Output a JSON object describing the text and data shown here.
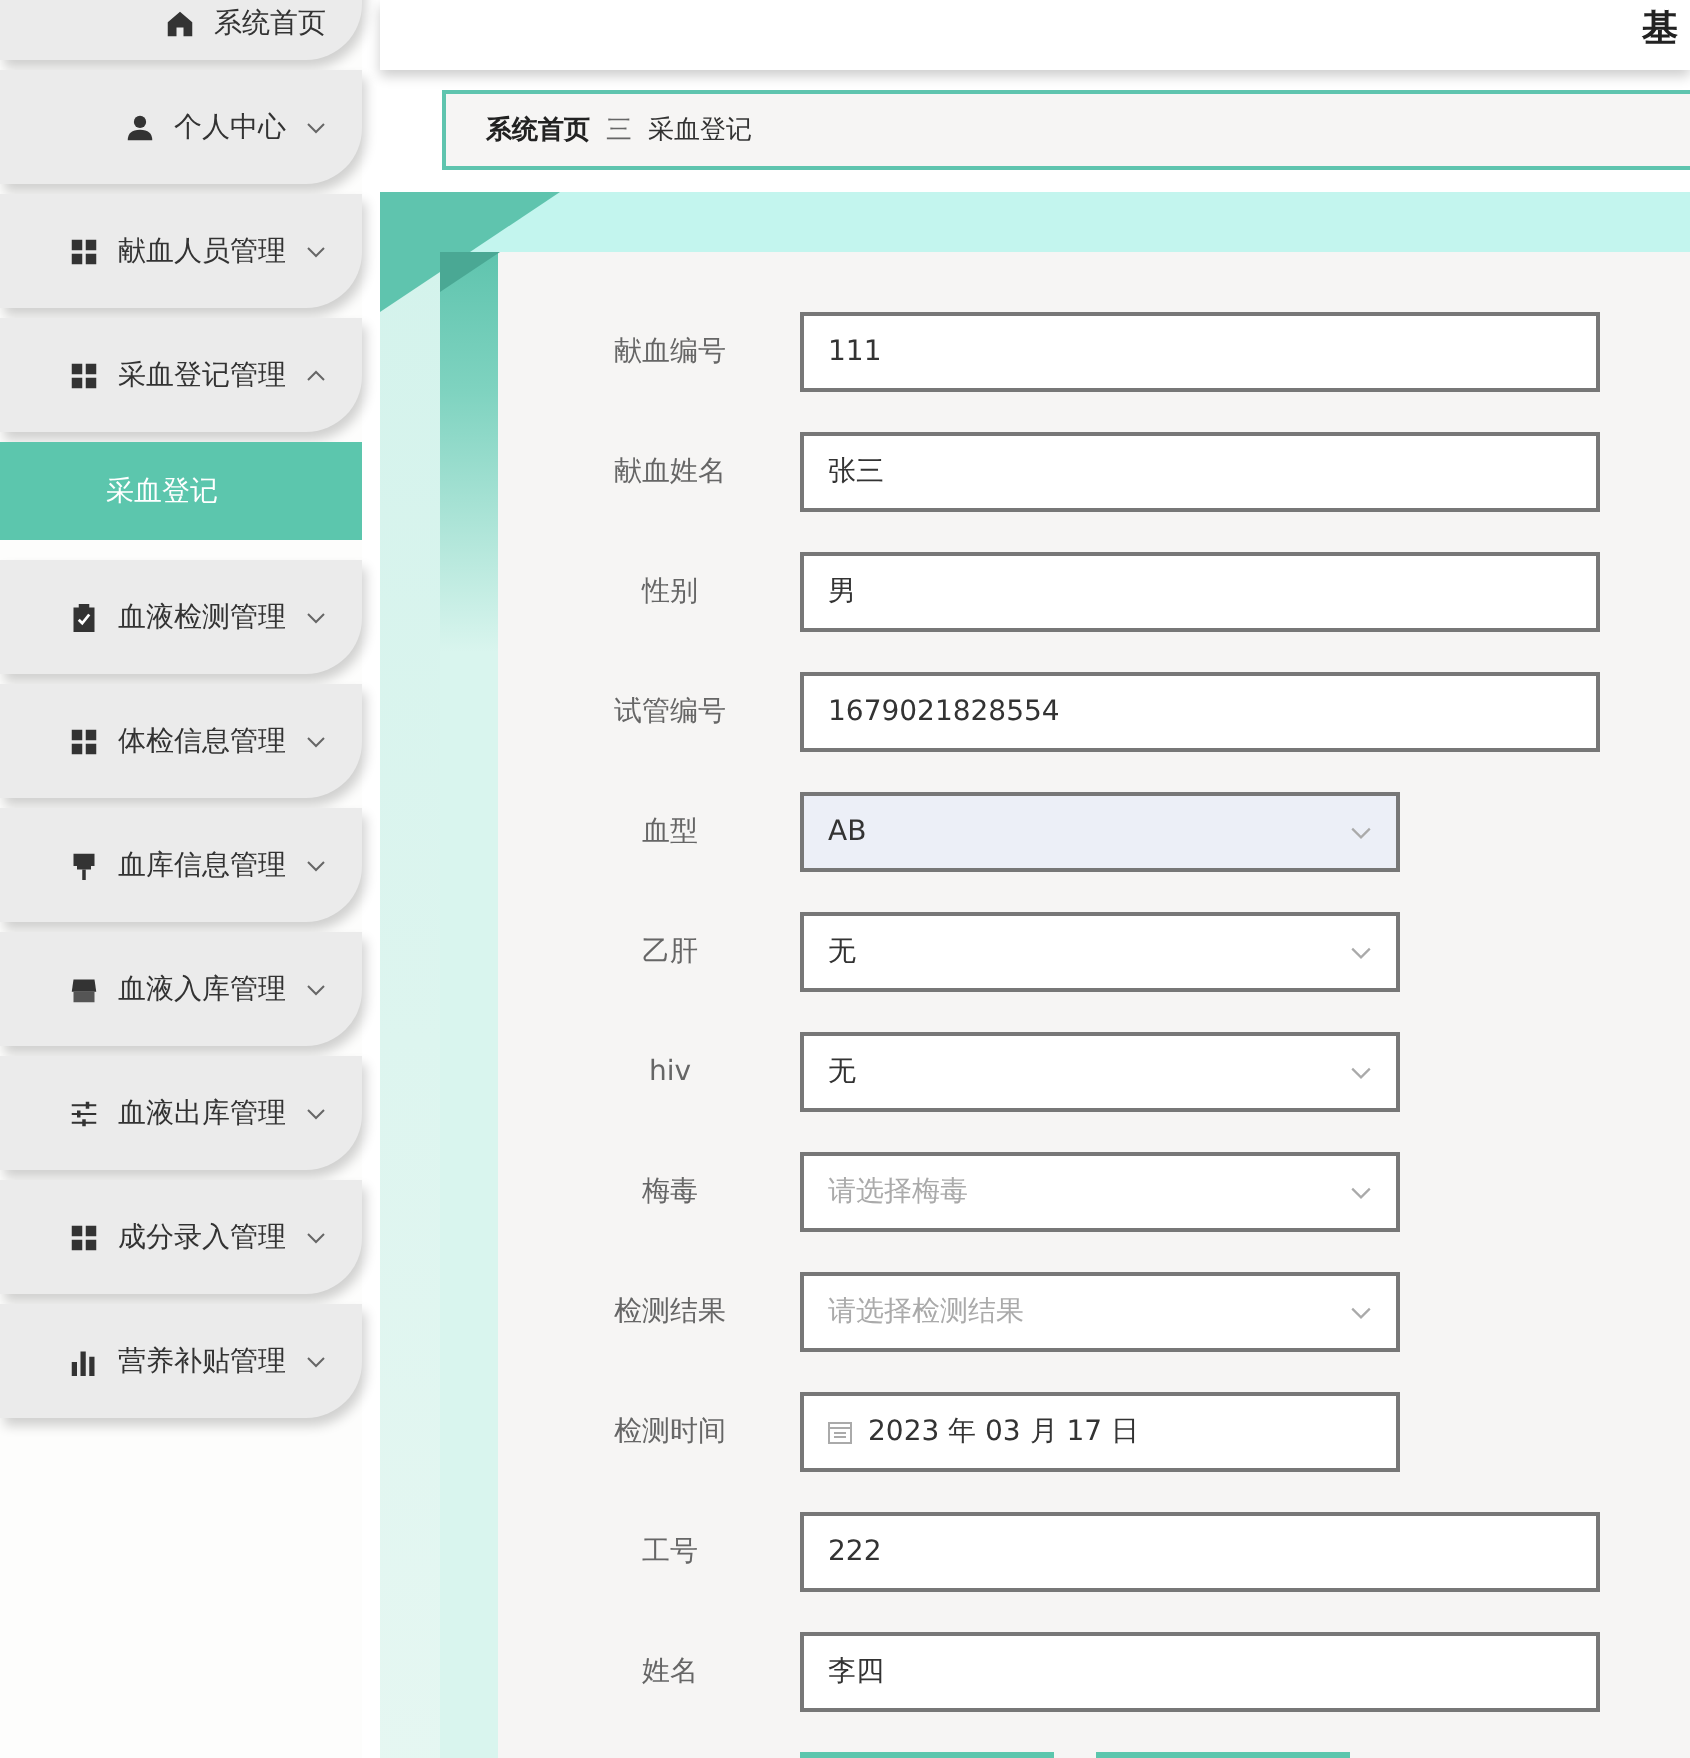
{
  "header": {
    "title": "基"
  },
  "sidebar": {
    "items": [
      {
        "kind": "link",
        "label": "系统首页"
      },
      {
        "kind": "menu",
        "label": "个人中心",
        "expanded": false
      },
      {
        "kind": "menu",
        "label": "献血人员管理",
        "expanded": false
      },
      {
        "kind": "menu",
        "label": "采血登记管理",
        "expanded": true,
        "children": [
          {
            "label": "采血登记",
            "selected": true
          }
        ]
      },
      {
        "kind": "menu",
        "label": "血液检测管理",
        "expanded": false
      },
      {
        "kind": "menu",
        "label": "体检信息管理",
        "expanded": false
      },
      {
        "kind": "menu",
        "label": "血库信息管理",
        "expanded": false
      },
      {
        "kind": "menu",
        "label": "血液入库管理",
        "expanded": false
      },
      {
        "kind": "menu",
        "label": "血液出库管理",
        "expanded": false
      },
      {
        "kind": "menu",
        "label": "成分录入管理",
        "expanded": false
      },
      {
        "kind": "menu",
        "label": "营养补贴管理",
        "expanded": false
      }
    ]
  },
  "breadcrumb": {
    "items": [
      "系统首页",
      "采血登记"
    ],
    "separator": "三"
  },
  "form": {
    "fields": [
      {
        "kind": "text",
        "label": "献血编号",
        "value": "111"
      },
      {
        "kind": "text",
        "label": "献血姓名",
        "value": "张三"
      },
      {
        "kind": "text",
        "label": "性别",
        "value": "男"
      },
      {
        "kind": "text",
        "label": "试管编号",
        "value": "1679021828554"
      },
      {
        "kind": "select",
        "label": "血型",
        "value": "AB",
        "hovered": true
      },
      {
        "kind": "select",
        "label": "乙肝",
        "value": "无",
        "hovered": false
      },
      {
        "kind": "select",
        "label": "hiv",
        "value": "无",
        "hovered": false
      },
      {
        "kind": "select",
        "label": "梅毒",
        "placeholder": "请选择梅毒",
        "hovered": false
      },
      {
        "kind": "select",
        "label": "检测结果",
        "placeholder": "请选择检测结果",
        "hovered": false
      },
      {
        "kind": "date",
        "label": "检测时间",
        "value": "2023 年 03 月 17 日"
      },
      {
        "kind": "text",
        "label": "工号",
        "value": "222"
      },
      {
        "kind": "text",
        "label": "姓名",
        "value": "李四"
      }
    ]
  }
}
